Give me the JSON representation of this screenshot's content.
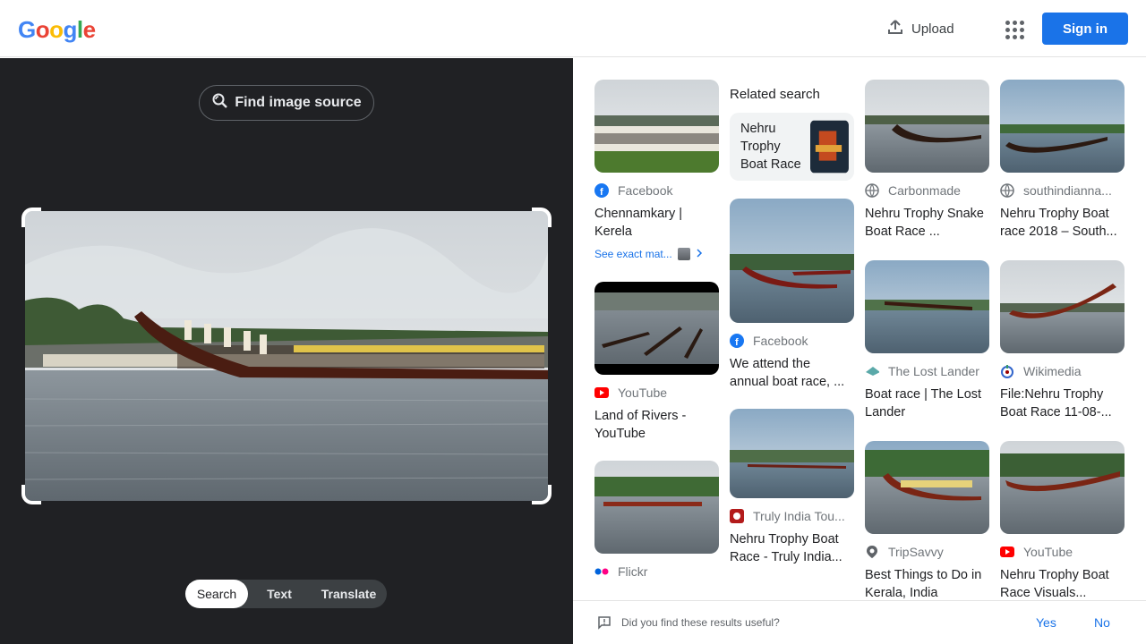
{
  "header": {
    "logo_letters": [
      "G",
      "o",
      "o",
      "g",
      "l",
      "e"
    ],
    "logo_colors": [
      "#4285F4",
      "#EA4335",
      "#FBBC05",
      "#4285F4",
      "#34A853",
      "#EA4335"
    ],
    "upload_label": "Upload",
    "apps_icon": "apps-grid-icon",
    "signin_label": "Sign in"
  },
  "lens": {
    "find_source_label": "Find image source",
    "tabs": [
      "Search",
      "Text",
      "Translate"
    ],
    "active_tab": "Search"
  },
  "results": {
    "col1": [
      {
        "source": "Facebook",
        "title": "Chennamkary | Kerela",
        "see_exact": "See exact mat..."
      },
      {
        "source": "YouTube",
        "title": "Land of Rivers - YouTube"
      },
      {
        "source": "Flickr",
        "title": ""
      }
    ],
    "related_search_label": "Related search",
    "related_query": "Nehru Trophy Boat Race",
    "col2": [
      {
        "source": "Facebook",
        "title": "We attend the annual boat race, ..."
      },
      {
        "source": "Truly India Tou...",
        "title": "Nehru Trophy Boat Race - Truly India..."
      }
    ],
    "col3": [
      {
        "source": "Carbonmade",
        "title": "Nehru Trophy Snake Boat Race ..."
      },
      {
        "source": "The Lost Lander",
        "title": "Boat race | The Lost Lander"
      },
      {
        "source": "TripSavvy",
        "title": "Best Things to Do in Kerala, India"
      }
    ],
    "col4": [
      {
        "source": "southindianna...",
        "title": "Nehru Trophy Boat race 2018 – South..."
      },
      {
        "source": "Wikimedia",
        "title": "File:Nehru Trophy Boat Race 11-08-..."
      },
      {
        "source": "YouTube",
        "title": "Nehru Trophy Boat Race Visuals..."
      }
    ]
  },
  "feedback": {
    "question": "Did you find these results useful?",
    "yes": "Yes",
    "no": "No"
  },
  "colors": {
    "accent": "#1a73e8",
    "dark_pane": "#202124"
  }
}
